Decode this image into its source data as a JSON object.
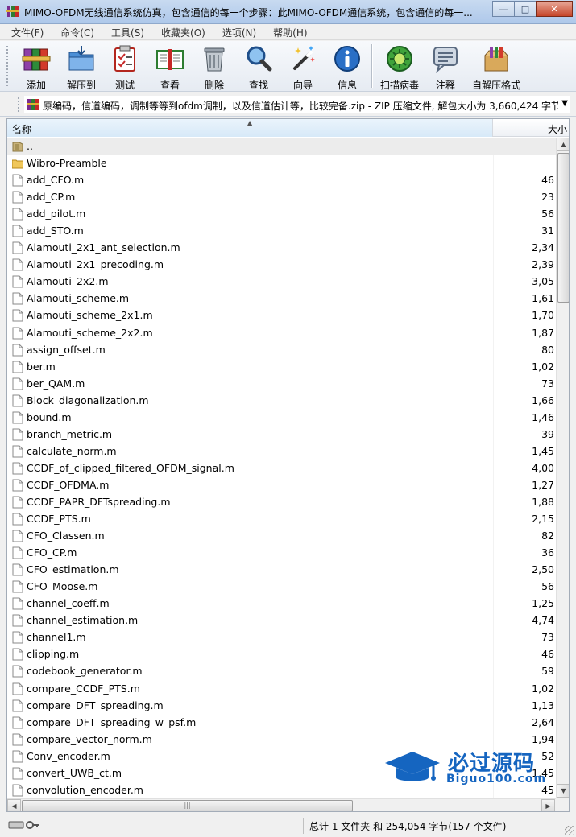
{
  "window": {
    "title": "MIMO-OFDM无线通信系统仿真，包含通信的每一个步骤：此MIMO-OFDM通信系统，包含通信的每一...",
    "minimize_glyph": "—",
    "maximize_glyph": "□",
    "close_glyph": "✕"
  },
  "menu": [
    {
      "label": "文件(F)"
    },
    {
      "label": "命令(C)"
    },
    {
      "label": "工具(S)"
    },
    {
      "label": "收藏夹(O)"
    },
    {
      "label": "选项(N)"
    },
    {
      "label": "帮助(H)"
    }
  ],
  "toolbar": [
    {
      "label": "添加",
      "icon": "books-add-icon"
    },
    {
      "label": "解压到",
      "icon": "folder-extract-icon"
    },
    {
      "label": "测试",
      "icon": "clipboard-test-icon"
    },
    {
      "label": "查看",
      "icon": "open-book-icon"
    },
    {
      "label": "删除",
      "icon": "trash-icon"
    },
    {
      "label": "查找",
      "icon": "magnifier-icon"
    },
    {
      "label": "向导",
      "icon": "magic-wand-icon"
    },
    {
      "label": "信息",
      "icon": "info-icon"
    },
    {
      "label": "扫描病毒",
      "icon": "virus-scan-icon"
    },
    {
      "label": "注释",
      "icon": "comment-icon"
    },
    {
      "label": "自解压格式",
      "icon": "sfx-box-icon"
    }
  ],
  "address": {
    "text": "原编码，信道编码，调制等等到ofdm调制，以及信道估计等，比较完备.zip - ZIP 压缩文件, 解包大小为 3,660,424 字节"
  },
  "columns": {
    "name": "名称",
    "size": "大小"
  },
  "files": [
    {
      "name": "..",
      "size": "",
      "type": "up"
    },
    {
      "name": "Wibro-Preamble",
      "size": "",
      "type": "folder"
    },
    {
      "name": "add_CFO.m",
      "size": "46",
      "type": "file"
    },
    {
      "name": "add_CP.m",
      "size": "23",
      "type": "file"
    },
    {
      "name": "add_pilot.m",
      "size": "56",
      "type": "file"
    },
    {
      "name": "add_STO.m",
      "size": "31",
      "type": "file"
    },
    {
      "name": "Alamouti_2x1_ant_selection.m",
      "size": "2,34",
      "type": "file"
    },
    {
      "name": "Alamouti_2x1_precoding.m",
      "size": "2,39",
      "type": "file"
    },
    {
      "name": "Alamouti_2x2.m",
      "size": "3,05",
      "type": "file"
    },
    {
      "name": "Alamouti_scheme.m",
      "size": "1,61",
      "type": "file"
    },
    {
      "name": "Alamouti_scheme_2x1.m",
      "size": "1,70",
      "type": "file"
    },
    {
      "name": "Alamouti_scheme_2x2.m",
      "size": "1,87",
      "type": "file"
    },
    {
      "name": "assign_offset.m",
      "size": "80",
      "type": "file"
    },
    {
      "name": "ber.m",
      "size": "1,02",
      "type": "file"
    },
    {
      "name": "ber_QAM.m",
      "size": "73",
      "type": "file"
    },
    {
      "name": "Block_diagonalization.m",
      "size": "1,66",
      "type": "file"
    },
    {
      "name": "bound.m",
      "size": "1,46",
      "type": "file"
    },
    {
      "name": "branch_metric.m",
      "size": "39",
      "type": "file"
    },
    {
      "name": "calculate_norm.m",
      "size": "1,45",
      "type": "file"
    },
    {
      "name": "CCDF_of_clipped_filtered_OFDM_signal.m",
      "size": "4,00",
      "type": "file"
    },
    {
      "name": "CCDF_OFDMA.m",
      "size": "1,27",
      "type": "file"
    },
    {
      "name": "CCDF_PAPR_DFTspreading.m",
      "size": "1,88",
      "type": "file"
    },
    {
      "name": "CCDF_PTS.m",
      "size": "2,15",
      "type": "file"
    },
    {
      "name": "CFO_Classen.m",
      "size": "82",
      "type": "file"
    },
    {
      "name": "CFO_CP.m",
      "size": "36",
      "type": "file"
    },
    {
      "name": "CFO_estimation.m",
      "size": "2,50",
      "type": "file"
    },
    {
      "name": "CFO_Moose.m",
      "size": "56",
      "type": "file"
    },
    {
      "name": "channel_coeff.m",
      "size": "1,25",
      "type": "file"
    },
    {
      "name": "channel_estimation.m",
      "size": "4,74",
      "type": "file"
    },
    {
      "name": "channel1.m",
      "size": "73",
      "type": "file"
    },
    {
      "name": "clipping.m",
      "size": "46",
      "type": "file"
    },
    {
      "name": "codebook_generator.m",
      "size": "59",
      "type": "file"
    },
    {
      "name": "compare_CCDF_PTS.m",
      "size": "1,02",
      "type": "file"
    },
    {
      "name": "compare_DFT_spreading.m",
      "size": "1,13",
      "type": "file"
    },
    {
      "name": "compare_DFT_spreading_w_psf.m",
      "size": "2,64",
      "type": "file"
    },
    {
      "name": "compare_vector_norm.m",
      "size": "1,94",
      "type": "file"
    },
    {
      "name": "Conv_encoder.m",
      "size": "52",
      "type": "file"
    },
    {
      "name": "convert_UWB_ct.m",
      "size": "1,45",
      "type": "file"
    },
    {
      "name": "convolution_encoder.m",
      "size": "45",
      "type": "file"
    }
  ],
  "watermark": {
    "title": "必过源码",
    "subtitle": "Biguo100.com"
  },
  "status": {
    "text": "总计 1 文件夹 和 254,054 字节(157 个文件)"
  },
  "colors": {
    "accent": "#1565c0",
    "title_bar": "#aec8ea",
    "selection": "#ececec"
  }
}
